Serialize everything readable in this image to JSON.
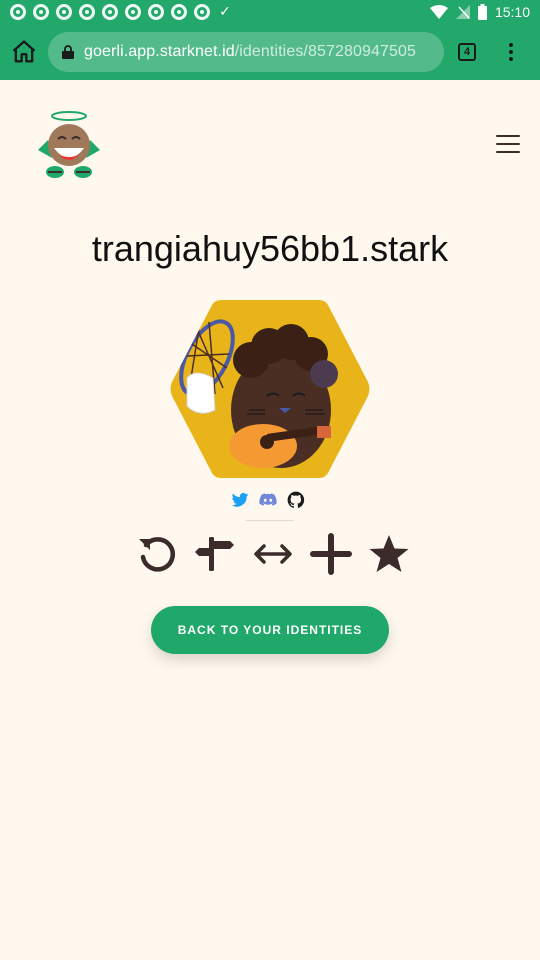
{
  "status_bar": {
    "time": "15:10",
    "notification_icons": [
      "chrome-icon",
      "chrome-icon",
      "chrome-icon",
      "chrome-icon",
      "chrome-icon",
      "chrome-icon",
      "chrome-icon",
      "chrome-icon",
      "chrome-icon",
      "checkmark-icon"
    ],
    "system_icons": [
      "wifi-icon",
      "signal-icon",
      "battery-icon"
    ]
  },
  "browser": {
    "url_host": "goerli.app.starknet.id",
    "url_path": "/identities/857280947505",
    "tab_count": "4"
  },
  "page": {
    "identity_name": "trangiahuy56bb1.stark",
    "socials": [
      "twitter-icon",
      "discord-icon",
      "github-icon"
    ],
    "actions": [
      "refresh-icon",
      "signpost-icon",
      "transfer-icon",
      "plus-icon",
      "star-icon"
    ],
    "back_button_label": "BACK TO YOUR IDENTITIES"
  },
  "colors": {
    "brand_green": "#1FA86A",
    "background": "#FEF8EE",
    "icon_dark": "#3B2B2B",
    "avatar_yellow": "#E8B419"
  }
}
